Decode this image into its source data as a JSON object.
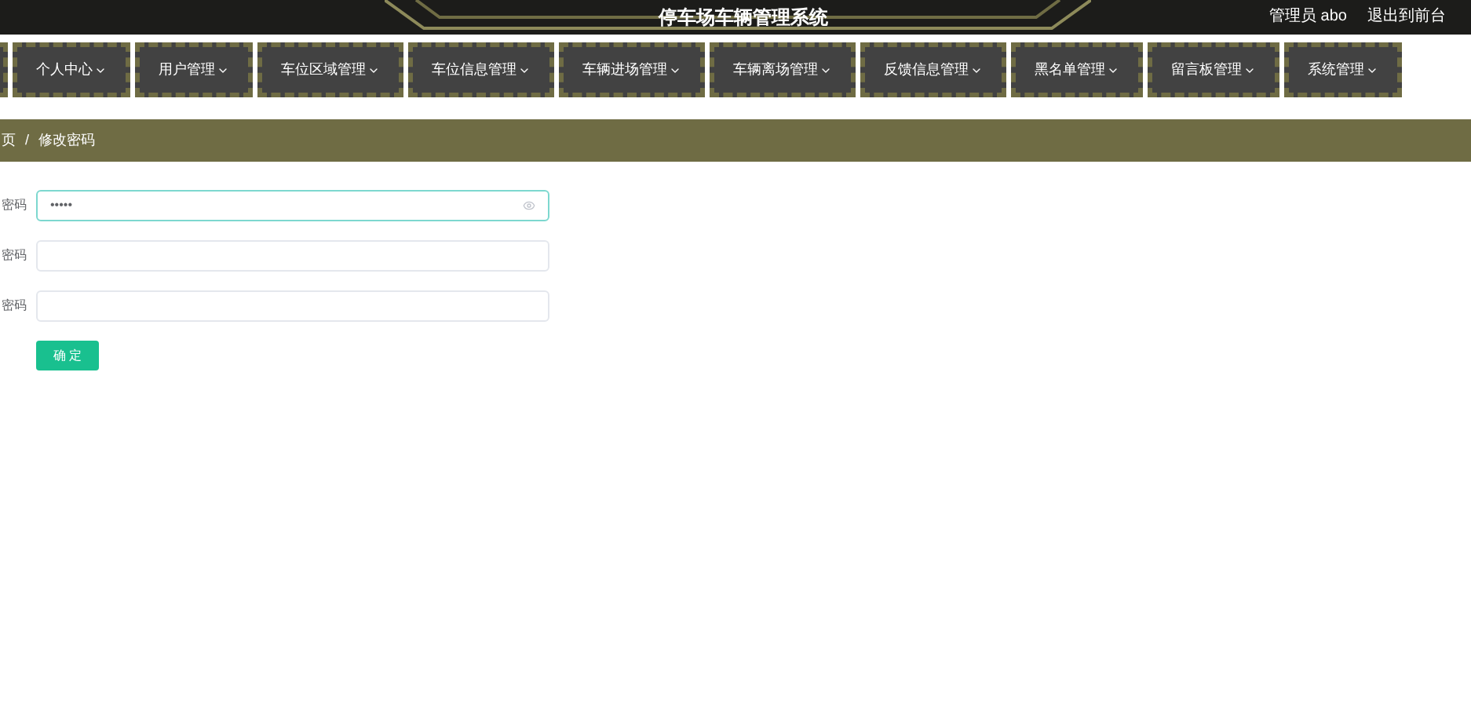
{
  "header": {
    "title": "停车场车辆管理系统",
    "links": [
      "管理员 abo",
      "退出到前台"
    ]
  },
  "nav": {
    "items": [
      {
        "label": "个人中心"
      },
      {
        "label": "用户管理"
      },
      {
        "label": "车位区域管理"
      },
      {
        "label": "车位信息管理"
      },
      {
        "label": "车辆进场管理"
      },
      {
        "label": "车辆离场管理"
      },
      {
        "label": "反馈信息管理"
      },
      {
        "label": "黑名单管理"
      },
      {
        "label": "留言板管理"
      },
      {
        "label": "系统管理"
      }
    ]
  },
  "breadcrumb": {
    "items": [
      "页",
      "修改密码"
    ],
    "separator": "/"
  },
  "form": {
    "fields": [
      {
        "label": "密码",
        "value": "•••••",
        "focused": true
      },
      {
        "label": "密码",
        "focused": false
      },
      {
        "label": "密码",
        "focused": false
      }
    ],
    "submit": "确 定"
  }
}
